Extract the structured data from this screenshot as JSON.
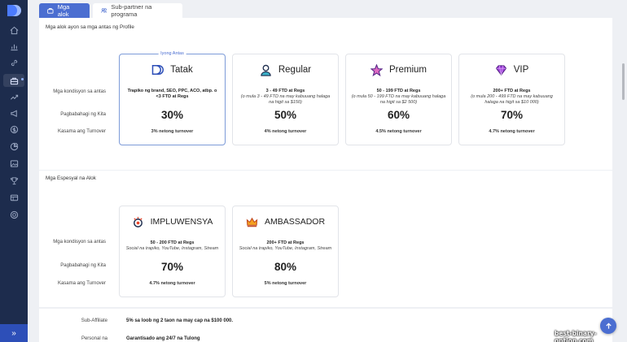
{
  "tabs": [
    {
      "label": "Mga alok"
    },
    {
      "label": "Sub-partner na programa"
    }
  ],
  "profile_section": {
    "title": "Mga alok ayon sa mga antas ng Profile",
    "row_labels": {
      "conditions": "Mga kondisyon sa antas",
      "profit_share": "Pagbabahagi ng Kita",
      "turnover": "Kasama ang Turnover"
    },
    "current_tag": "Iyong Antas",
    "levels": [
      {
        "name": "Tatak",
        "icon": "brand-logo-icon",
        "condition": "Trapiko ng brand, SEO, PPC, ACO, atbp. o <3 FTD at Regs",
        "condition_note": "",
        "share": "30%",
        "turnover": "3% netong turnover"
      },
      {
        "name": "Regular",
        "icon": "user-icon",
        "condition": "3 - 49 FTD at Regs",
        "condition_note": "(o mula 3 - 49 FTD na may kabuuang halaga na higit sa $150)",
        "share": "50%",
        "turnover": "4% netong turnover"
      },
      {
        "name": "Premium",
        "icon": "star-icon",
        "condition": "50 - 199 FTD at Regs",
        "condition_note": "(o mula 50 - 199 FTD na may kabuuang halaga na higit sa $2 500)",
        "share": "60%",
        "turnover": "4.5% netong turnover"
      },
      {
        "name": "VIP",
        "icon": "diamond-icon",
        "condition": "200+ FTD at Regs",
        "condition_note": "(o mula 200 - 499 FTD na may kabuuang halaga na higit sa $10 000)",
        "share": "70%",
        "turnover": "4.7% netong turnover"
      }
    ]
  },
  "special_section": {
    "title": "Mga Espesyal na Alok",
    "row_labels": {
      "conditions": "Mga kondisyon sa antas",
      "profit_share": "Pagbabahagi ng Kita",
      "turnover": "Kasama ang Turnover"
    },
    "offers": [
      {
        "name": "IMPLUWENSYA",
        "icon": "influencer-icon",
        "condition": "50 - 200 FTD at Regs",
        "condition_note": "Social na trapiko, YouTube, Instagram, Stream",
        "share": "70%",
        "turnover": "4.7% netong turnover"
      },
      {
        "name": "AMBASSADOR",
        "icon": "crown-icon",
        "condition": "200+ FTD at Regs",
        "condition_note": "Social na trapiko, YouTube, Instagram, Stream",
        "share": "80%",
        "turnover": "5% netong turnover"
      }
    ]
  },
  "extras": [
    {
      "label": "Sub-Affiliate",
      "value": "5% sa loob ng 2 taon na may cap na $100 000."
    },
    {
      "label": "Personal na",
      "value": "Garantisado ang 24/7 na Tulong"
    }
  ],
  "watermark": "best-binary-option.com",
  "colors": {
    "sidebar": "#1d2c4d",
    "accent": "#4b6ed1",
    "background": "#eef0f4"
  }
}
